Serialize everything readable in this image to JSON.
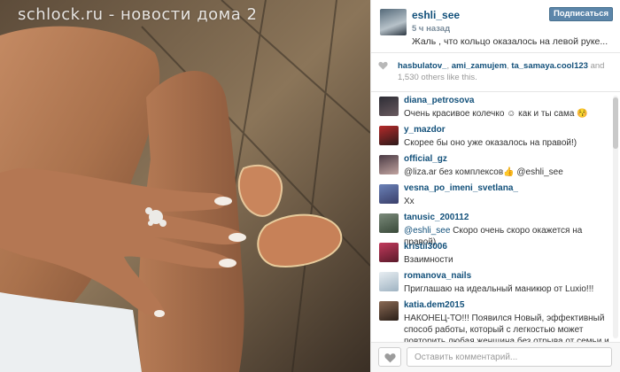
{
  "watermark": "schlock.ru - новости дома 2",
  "post": {
    "author": "eshli_see",
    "time": "5 ч назад",
    "caption": "Жаль , что кольцо оказалось на левой руке...",
    "follow_label": "Подписаться"
  },
  "likes": {
    "users": [
      "hasbulatov_",
      "ami_zamujem",
      "ta_samaya.cool123"
    ],
    "sep1": ", ",
    "sep2": ", ",
    "and_word": " and",
    "others": "1,530",
    "others_suffix": " others like this."
  },
  "comments": [
    {
      "user": "diana_petrosova",
      "mention": "",
      "text": "Очень красивое колечко ☺ как и ты сама 😚",
      "avatar_color": "#2d2d35"
    },
    {
      "user": "y_mazdor",
      "mention": "",
      "text": "Скорее бы оно уже оказалось на правой!)",
      "avatar_color": "#b52a2a"
    },
    {
      "user": "official_gz",
      "mention": "",
      "text": "@liza.ar без комплексов👍 @eshli_see",
      "avatar_color": "#4a3a44"
    },
    {
      "user": "vesna_po_imeni_svetlana_",
      "mention": "",
      "text": "Хх",
      "avatar_color": "#6b82b8"
    },
    {
      "user": "tanusic_200112",
      "mention": "@eshli_see",
      "text": " Скоро очень скоро окажется на правой)",
      "avatar_color": "#7a8a7a"
    },
    {
      "user": "kristii3006",
      "mention": "",
      "text": "Взаимности",
      "avatar_color": "#c23a5c"
    },
    {
      "user": "romanova_nails",
      "mention": "",
      "text": "Приглашаю на идеальный маникюр от Luxio!!!",
      "avatar_color": "#e8eef2"
    },
    {
      "user": "katia.dem2015",
      "mention": "",
      "text": "НАКОНЕЦ-ТО!!! Появился Новый, эффективный способ работы, который с легкостью может повторить любая женщина без отрыва от семьи и",
      "avatar_color": "#8a6a55"
    }
  ],
  "footer": {
    "comment_placeholder": "Оставить комментарий..."
  },
  "icons": {
    "like": "heart-icon",
    "likes_heart": "heart-icon"
  },
  "colors": {
    "username": "#12507a",
    "follow_button": "#5c86aa"
  }
}
